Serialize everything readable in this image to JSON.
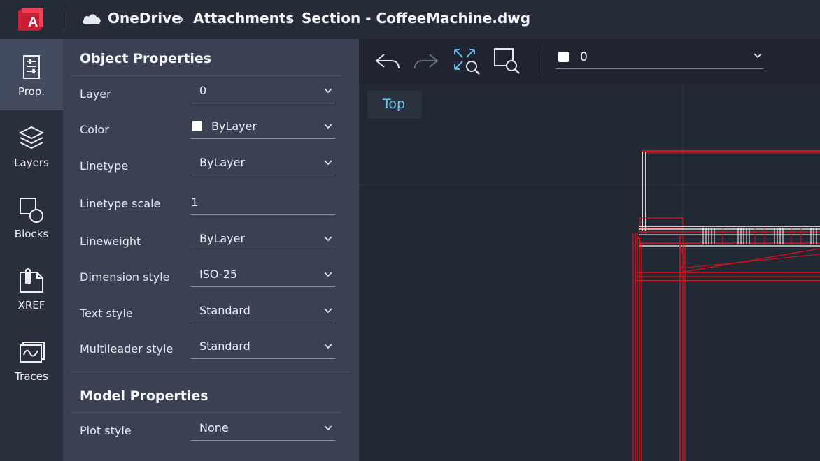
{
  "header": {
    "app_logo_letter": "A",
    "breadcrumb": [
      "OneDrive",
      "Attachments",
      "Section - CoffeeMachine.dwg"
    ]
  },
  "rail": {
    "items": [
      {
        "label": "Prop.",
        "icon": "properties-icon",
        "active": true
      },
      {
        "label": "Layers",
        "icon": "layers-icon",
        "active": false
      },
      {
        "label": "Blocks",
        "icon": "blocks-icon",
        "active": false
      },
      {
        "label": "XREF",
        "icon": "xref-icon",
        "active": false
      },
      {
        "label": "Traces",
        "icon": "traces-icon",
        "active": false
      }
    ]
  },
  "panel": {
    "object_title": "Object Properties",
    "model_title": "Model Properties",
    "props": {
      "layer": {
        "label": "Layer",
        "value": "0"
      },
      "color": {
        "label": "Color",
        "value": "ByLayer"
      },
      "linetype": {
        "label": "Linetype",
        "value": "ByLayer"
      },
      "linetype_scale": {
        "label": "Linetype scale",
        "value": "1"
      },
      "lineweight": {
        "label": "Lineweight",
        "value": "ByLayer"
      },
      "dimension_style": {
        "label": "Dimension style",
        "value": "ISO-25"
      },
      "text_style": {
        "label": "Text style",
        "value": "Standard"
      },
      "multileader_style": {
        "label": "Multileader style",
        "value": "Standard"
      },
      "plot_style": {
        "label": "Plot style",
        "value": "None"
      }
    }
  },
  "toolbar": {
    "current_layer": "0"
  },
  "canvas": {
    "view_label": "Top"
  },
  "colors": {
    "accent_logo": "#e8273c",
    "view_label": "#6cc4f0",
    "drawing_lines": "#e0101a"
  }
}
